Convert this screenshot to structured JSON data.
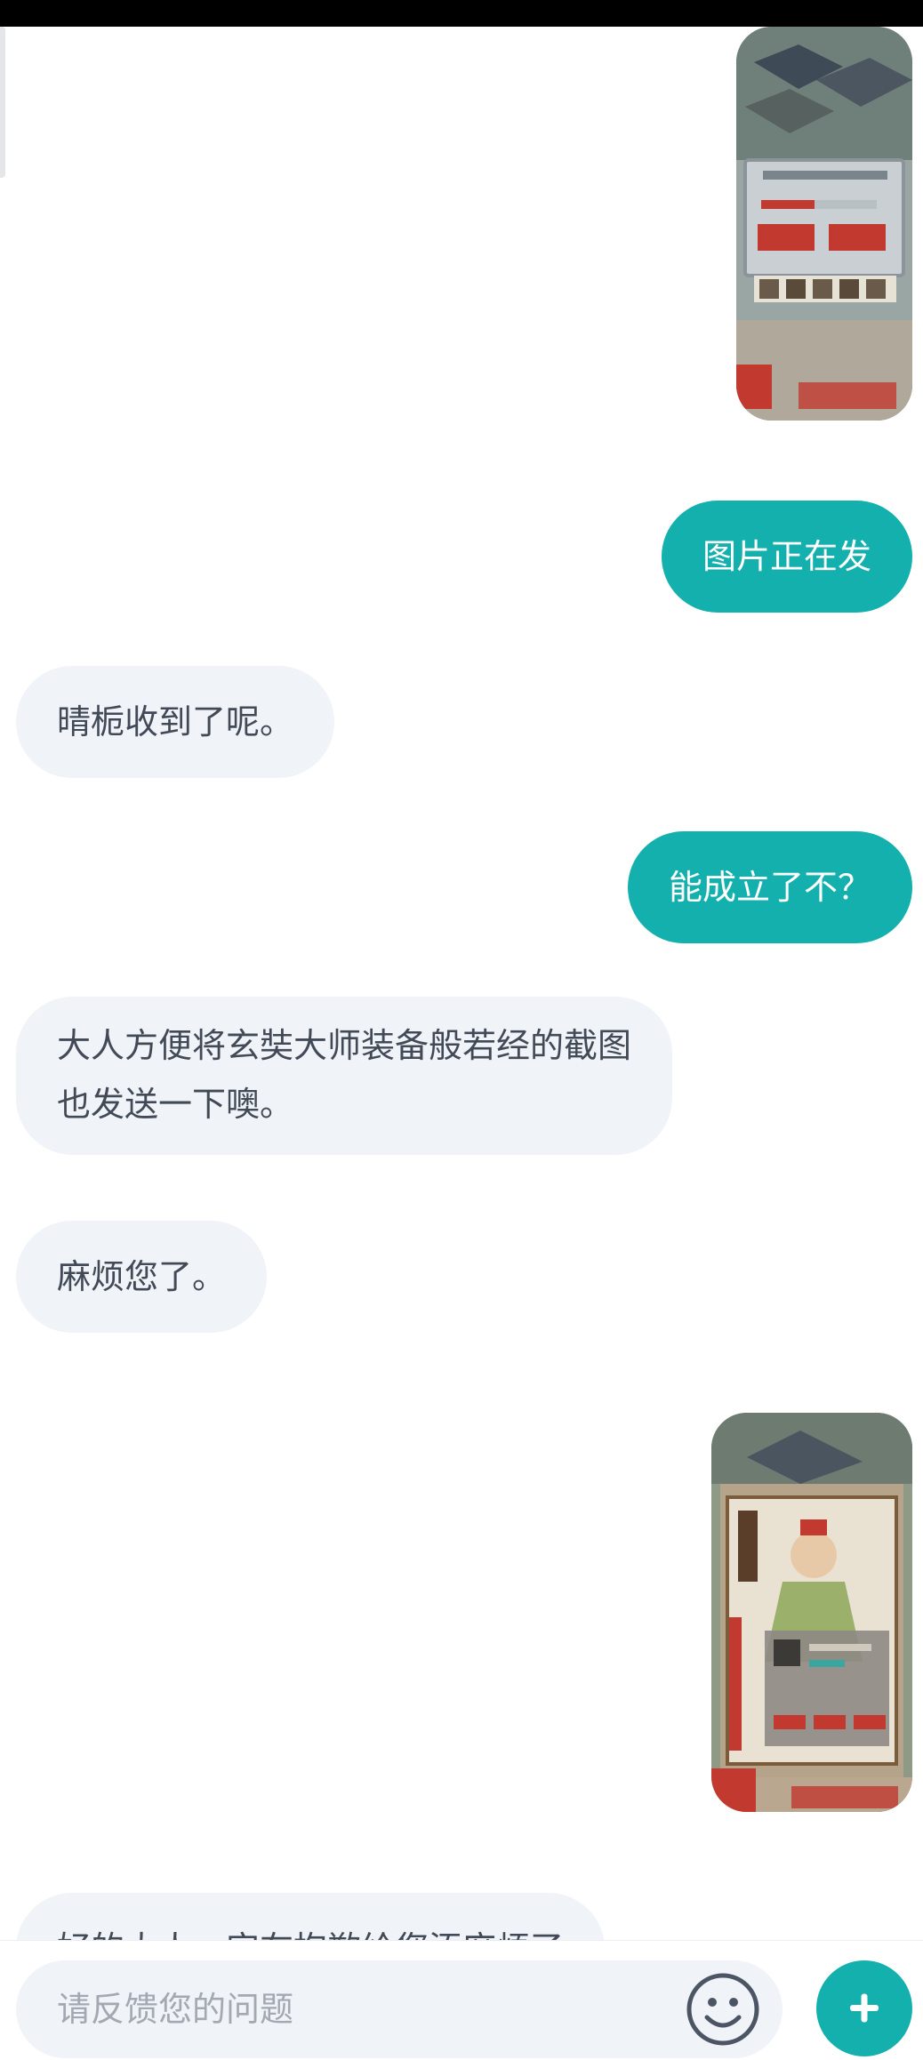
{
  "messages": [
    {
      "id": "m1",
      "sender": "user",
      "kind": "image",
      "subject": "game-screenshot-city"
    },
    {
      "id": "m2",
      "sender": "user",
      "kind": "text",
      "lines": [
        "图片正在发"
      ]
    },
    {
      "id": "m3",
      "sender": "agent",
      "kind": "text",
      "lines": [
        "晴栀收到了呢。"
      ]
    },
    {
      "id": "m4",
      "sender": "user",
      "kind": "text",
      "lines": [
        "能成立了不？"
      ]
    },
    {
      "id": "m5",
      "sender": "agent",
      "kind": "text",
      "lines": [
        "大人方便将玄奘大师装备般若经的截图",
        "也发送一下噢。"
      ]
    },
    {
      "id": "m6",
      "sender": "agent",
      "kind": "text",
      "lines": [
        "麻烦您了。"
      ]
    },
    {
      "id": "m7",
      "sender": "user",
      "kind": "image",
      "subject": "game-screenshot-character"
    },
    {
      "id": "m8",
      "sender": "agent",
      "kind": "text",
      "lines": [
        "好的大人，实在抱歉给您添麻烦了"
      ]
    }
  ],
  "composer": {
    "placeholder": "请反馈您的问题",
    "emoji_icon": "smiley-icon",
    "add_icon": "plus-icon"
  },
  "colors": {
    "accent": "#13b0ad",
    "agent_bubble": "#f0f3f7",
    "agent_text": "#424a57",
    "placeholder": "#a3a9b2"
  }
}
